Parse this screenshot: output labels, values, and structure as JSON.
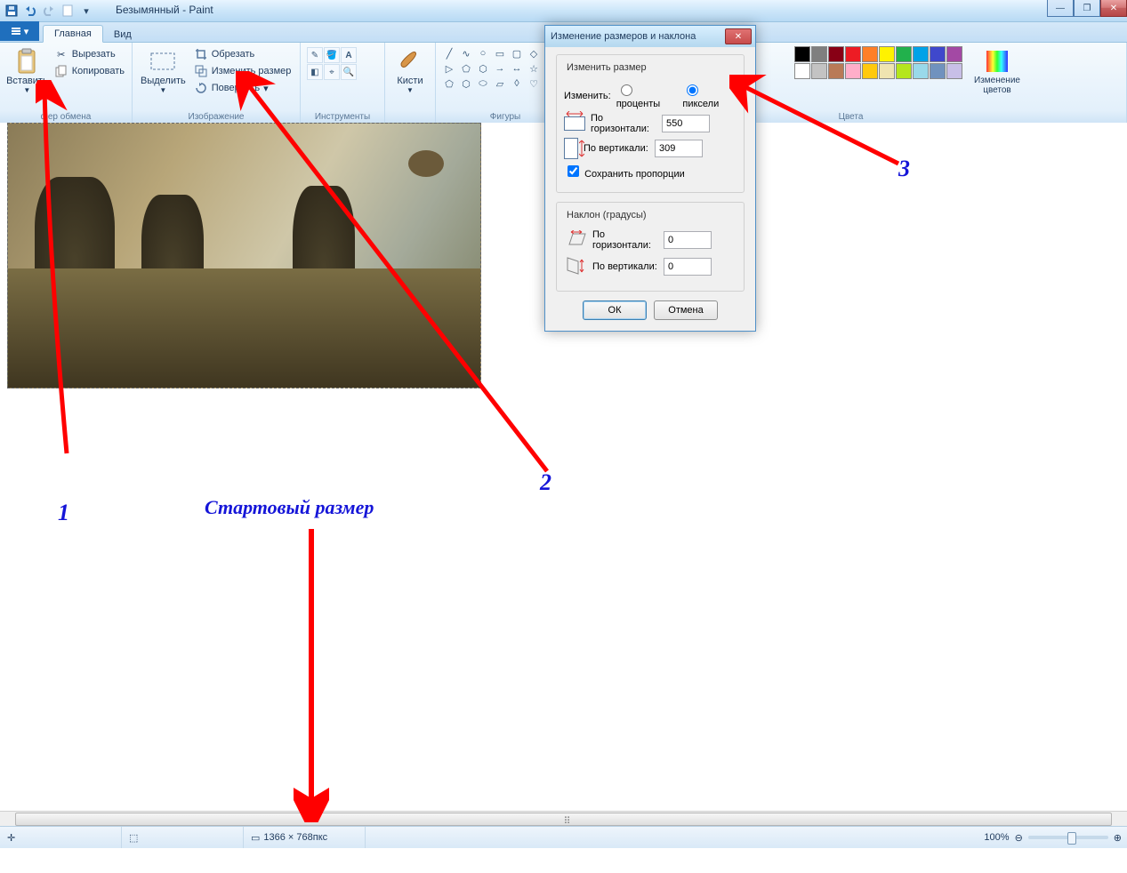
{
  "title": "Безымянный - Paint",
  "tabs": {
    "home": "Главная",
    "view": "Вид"
  },
  "ribbon": {
    "clipboard": {
      "label": "фер обмена",
      "paste": "Вставить",
      "cut": "Вырезать",
      "copy": "Копировать"
    },
    "image": {
      "label": "Изображение",
      "select": "Выделить",
      "crop": "Обрезать",
      "resize": "Изменить размер",
      "rotate": "Повернуть"
    },
    "tools": {
      "label": "Инструменты"
    },
    "brushes": {
      "label": "Кисти"
    },
    "shapes": {
      "label": "Фигуры"
    },
    "colors": {
      "label": "Цвета",
      "edit": "Изменение\nцветов"
    }
  },
  "palette": [
    "#000000",
    "#7f7f7f",
    "#880015",
    "#ed1c24",
    "#ff7f27",
    "#fff200",
    "#22b14c",
    "#00a2e8",
    "#3f48cc",
    "#a349a4",
    "#ffffff",
    "#c3c3c3",
    "#b97a57",
    "#ffaec9",
    "#ffc90e",
    "#efe4b0",
    "#b5e61d",
    "#99d9ea",
    "#7092be",
    "#c8bfe7"
  ],
  "dialog": {
    "title": "Изменение размеров и наклона",
    "resize_group": "Изменить размер",
    "by_label": "Изменить:",
    "percent": "проценты",
    "pixels": "пиксели",
    "horizontal": "По горизонтали:",
    "vertical": "По вертикали:",
    "h_val": "550",
    "v_val": "309",
    "keep_ratio": "Сохранить пропорции",
    "skew_group": "Наклон (градусы)",
    "skew_h": "0",
    "skew_v": "0",
    "vertical_short": "По вертикали:",
    "ok": "ОК",
    "cancel": "Отмена"
  },
  "status": {
    "size": "1366 × 768пкс",
    "zoom": "100%"
  },
  "anno": {
    "n1": "1",
    "n2": "2",
    "n3": "3",
    "start": "Стартовый размер"
  }
}
